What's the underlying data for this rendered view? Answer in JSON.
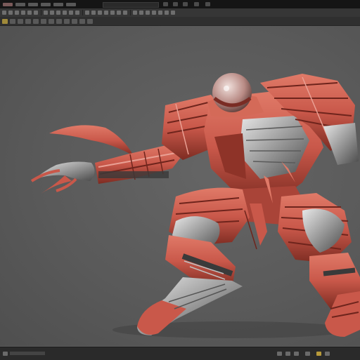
{
  "topbar": {
    "menu_count": 9
  },
  "toolbar": {
    "icon_count": 44
  },
  "toolbar2": {
    "icon_count": 20
  },
  "colors": {
    "background": "#5a5a5a",
    "armor_red": "#c9584a",
    "armor_dark_red": "#8e3328",
    "metal": "#b8b8b8",
    "highlight": "#a08a3a"
  },
  "viewport": {
    "model": "3d-robot-creature"
  }
}
